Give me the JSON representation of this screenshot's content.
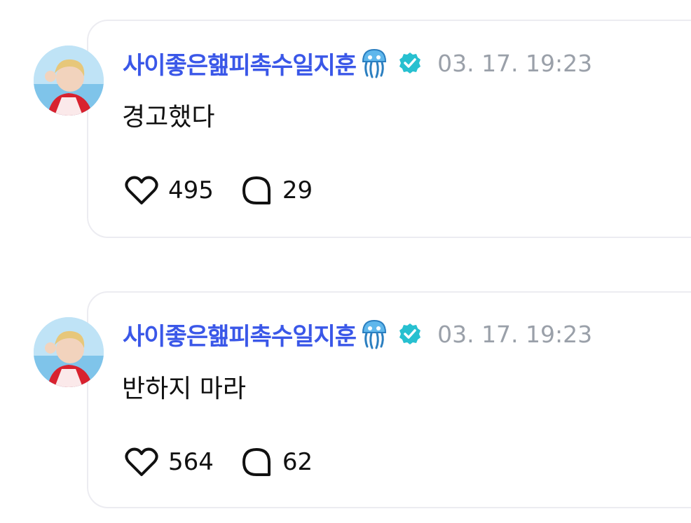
{
  "posts": [
    {
      "username": "사이좋은햂피촉수일지훈",
      "badge_icon": "jellyfish-icon",
      "verified_icon": "verified-badge-icon",
      "timestamp": "03. 17. 19:23",
      "text": "경고했다",
      "likes": "495",
      "comments": "29"
    },
    {
      "username": "사이좋은햂피촉수일지훈",
      "badge_icon": "jellyfish-icon",
      "verified_icon": "verified-badge-icon",
      "timestamp": "03. 17. 19:23",
      "text": "반하지 마라",
      "likes": "564",
      "comments": "62"
    }
  ],
  "colors": {
    "username": "#3a57e8",
    "timestamp": "#9aa0a9",
    "verified": "#27c0d0",
    "card_border": "#ececf1"
  }
}
